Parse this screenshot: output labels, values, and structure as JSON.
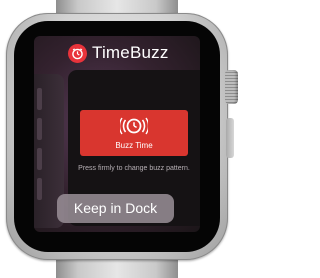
{
  "app": {
    "name": "TimeBuzz",
    "icon": "alarm-clock-icon",
    "accent_color": "#e9333b"
  },
  "buzz_button": {
    "label": "Buzz Time",
    "icon": "alarm-clock-icon",
    "color": "#d9362f"
  },
  "hint": {
    "text": "Press firmly to change buzz pattern."
  },
  "dock_button": {
    "label": "Keep in Dock"
  }
}
